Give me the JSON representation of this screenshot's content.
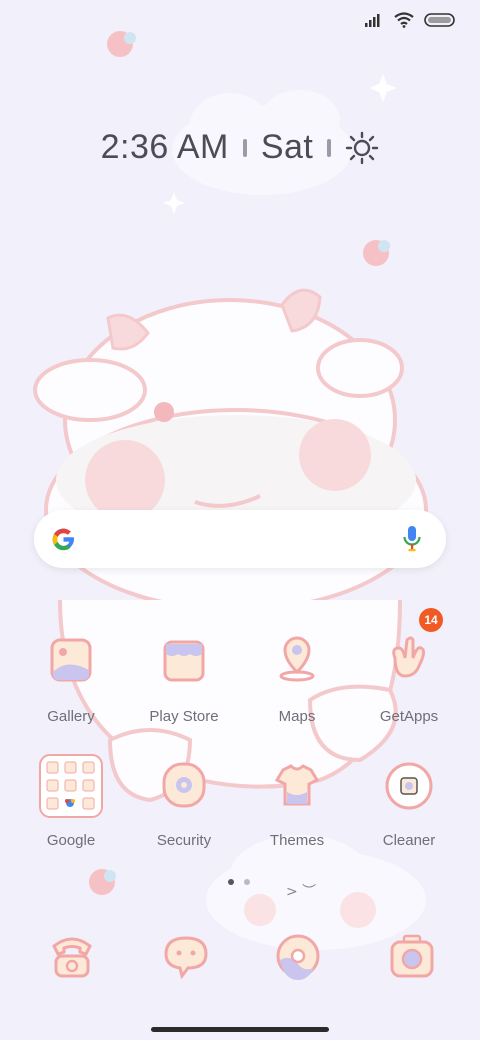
{
  "status_bar": {
    "signal_icon": "signal-bars-icon",
    "wifi_icon": "wifi-icon",
    "battery_icon": "battery-icon"
  },
  "clock_widget": {
    "time": "2:36 AM",
    "day": "Sat",
    "weather_icon": "sun-icon"
  },
  "search_bar": {
    "logo_icon": "google-g-icon",
    "mic_icon": "microphone-icon"
  },
  "apps_row1": [
    {
      "label": "Gallery"
    },
    {
      "label": "Play Store"
    },
    {
      "label": "Maps"
    },
    {
      "label": "GetApps",
      "badge": "14"
    }
  ],
  "apps_row2": [
    {
      "label": "Google"
    },
    {
      "label": "Security"
    },
    {
      "label": "Themes"
    },
    {
      "label": "Cleaner"
    }
  ],
  "page_indicator": {
    "pages": 2,
    "active": 1
  },
  "dock": [
    {
      "icon": "phone-icon"
    },
    {
      "icon": "messages-icon"
    },
    {
      "icon": "browser-icon"
    },
    {
      "icon": "camera-icon"
    }
  ],
  "colors": {
    "accent_pink": "#f2a7a7",
    "icon_fill": "#fde9d7",
    "icon_purple": "#c9c5ef",
    "badge": "#f15a24"
  }
}
